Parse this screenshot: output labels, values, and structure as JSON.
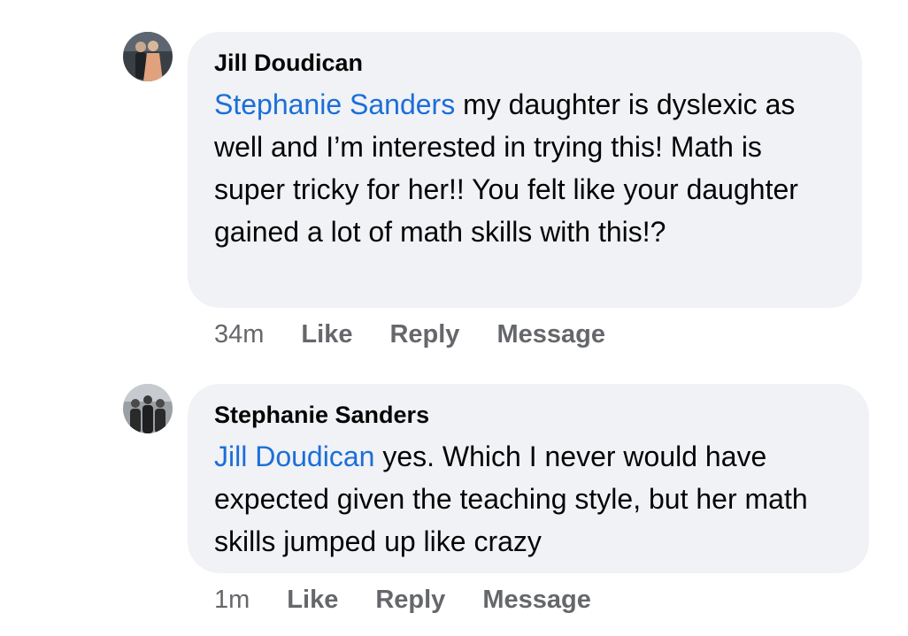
{
  "comments": [
    {
      "author": "Jill Doudican",
      "mention": "Stephanie Sanders",
      "text": " my daughter is dyslexic as well and I’m interested in trying this! Math is super tricky for her!! You felt like your daughter gained a lot of math skills with this!?",
      "time": "34m",
      "like_label": "Like",
      "reply_label": "Reply",
      "message_label": "Message"
    },
    {
      "author": "Stephanie Sanders",
      "mention": "Jill Doudican",
      "text": " yes. Which I never would have expected given the teaching style, but her math skills jumped up like crazy",
      "time": "1m",
      "like_label": "Like",
      "reply_label": "Reply",
      "message_label": "Message"
    }
  ],
  "colors": {
    "bubble": "#f0f2f5",
    "mention": "#1c6ed8",
    "secondary_text": "#65676b",
    "primary_text": "#050505"
  }
}
